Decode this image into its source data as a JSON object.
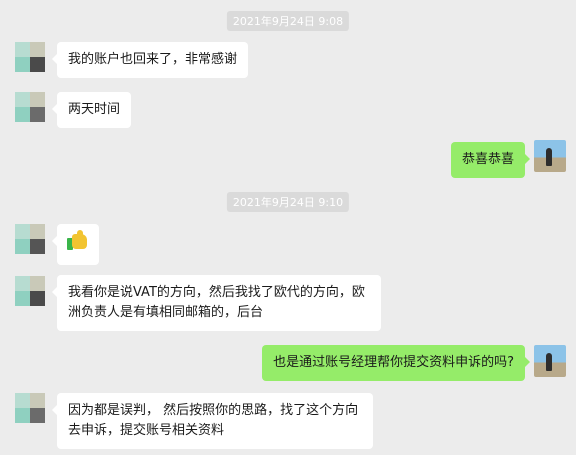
{
  "timestamps": [
    "2021年9月24日 9:08",
    "2021年9月24日 9:10"
  ],
  "messages": [
    {
      "side": "left",
      "text": "我的账户也回来了，非常感谢"
    },
    {
      "side": "left",
      "text": "两天时间"
    },
    {
      "side": "right",
      "text": "恭喜恭喜"
    },
    {
      "side": "left",
      "type": "emoji",
      "emoji": "thumbs-up"
    },
    {
      "side": "left",
      "text": "我看你是说VAT的方向，然后我找了欧代的方向，欧洲负责人是有填相同邮箱的，后台"
    },
    {
      "side": "right",
      "text": "也是通过账号经理帮你提交资料申诉的吗?"
    },
    {
      "side": "left",
      "text": "因为都是误判，  然后按照你的思路，找了这个方向去申诉，提交账号相关资料"
    }
  ],
  "colors": {
    "background": "#ececec",
    "bubble_left": "#ffffff",
    "bubble_right": "#95ec69",
    "timestamp_bg": "#dadada"
  }
}
